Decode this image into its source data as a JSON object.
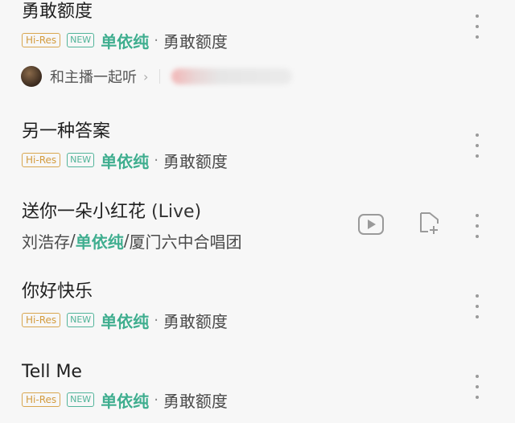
{
  "songs": [
    {
      "title": "勇敢额度",
      "badges": {
        "hires": "Hi-Res",
        "new": "NEW"
      },
      "artist": "单依纯",
      "separator": "·",
      "album": "勇敢额度"
    },
    {
      "title": "另一种答案",
      "badges": {
        "hires": "Hi-Res",
        "new": "NEW"
      },
      "artist": "单依纯",
      "separator": "·",
      "album": "勇敢额度"
    },
    {
      "title": "送你一朵小红花",
      "title_suffix": "(Live)",
      "artists": [
        "刘浩存",
        "单依纯",
        "厦门六中合唱团"
      ],
      "artist_sep": "/"
    },
    {
      "title": "你好快乐",
      "badges": {
        "hires": "Hi-Res",
        "new": "NEW"
      },
      "artist": "单依纯",
      "separator": "·",
      "album": "勇敢额度"
    },
    {
      "title": "Tell Me",
      "badges": {
        "hires": "Hi-Res",
        "new": "NEW"
      },
      "artist": "单依纯",
      "separator": "·",
      "album": "勇敢额度"
    }
  ],
  "listen_together": {
    "label": "和主播一起听",
    "chevron": "›"
  },
  "icons": {
    "more": "more-vertical-icon",
    "video": "video-play-icon",
    "add_to_playlist": "add-to-playlist-icon"
  },
  "colors": {
    "accent": "#3fae8f",
    "hires": "#d39b3e",
    "background": "#f7f7f7"
  }
}
